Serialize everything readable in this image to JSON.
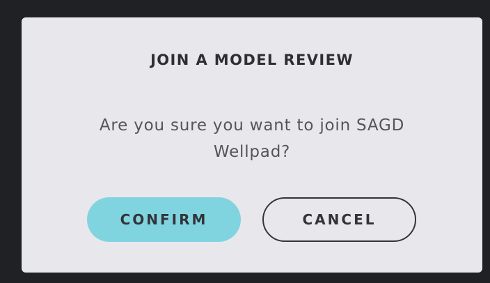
{
  "dialog": {
    "title": "JOIN A MODEL REVIEW",
    "message": "Are you sure you want to join SAGD Wellpad?",
    "confirm_label": "CONFIRM",
    "cancel_label": "CANCEL"
  },
  "colors": {
    "backdrop": "#202124",
    "dialog_background": "#e8e7ec",
    "confirm_background": "#80d4e0",
    "text_dark": "#2e2e33",
    "text_muted": "#54545b"
  }
}
